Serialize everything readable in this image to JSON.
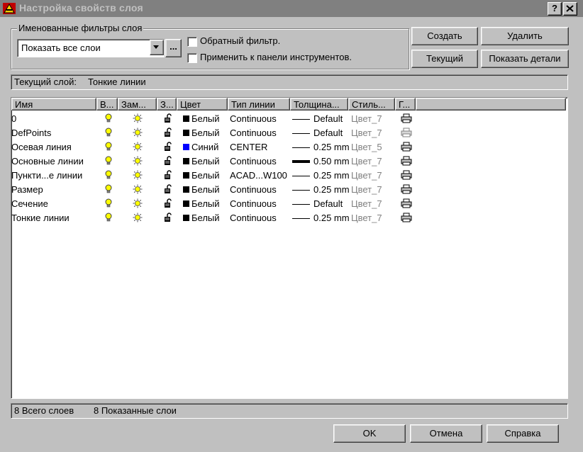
{
  "window": {
    "title": "Настройка свойств слоя",
    "help_glyph": "?",
    "close_glyph": "✕"
  },
  "filters": {
    "group_label": "Именованные фильтры слоя",
    "selected": "Показать все слои",
    "dots_label": "...",
    "invert_label": "Обратный фильтр.",
    "apply_toolbar_label": "Применить к панели инструментов."
  },
  "buttons": {
    "new": "Создать",
    "delete": "Удалить",
    "current": "Текущий",
    "show_details": "Показать детали",
    "ok": "OK",
    "cancel": "Отмена",
    "help": "Справка"
  },
  "current_layer": {
    "label": "Текущий слой:",
    "value": "Тонкие линии"
  },
  "columns": [
    "Имя",
    "В...",
    "Зам...",
    "З...",
    "Цвет",
    "Тип линии",
    "Толщина...",
    "Стиль...",
    "Г..."
  ],
  "layers": [
    {
      "name": "0",
      "color_name": "Белый",
      "color_hex": "#000000",
      "linetype": "Continuous",
      "lineweight": "Default",
      "lw_thick": false,
      "style": "Цвет_7",
      "plot": "on"
    },
    {
      "name": "DefPoints",
      "color_name": "Белый",
      "color_hex": "#000000",
      "linetype": "Continuous",
      "lineweight": "Default",
      "lw_thick": false,
      "style": "Цвет_7",
      "plot": "off"
    },
    {
      "name": "Осевая линия",
      "color_name": "Синий",
      "color_hex": "#0000ff",
      "linetype": "CENTER",
      "lineweight": "0.25 mm",
      "lw_thick": false,
      "style": "Цвет_5",
      "plot": "on"
    },
    {
      "name": "Основные линии",
      "color_name": "Белый",
      "color_hex": "#000000",
      "linetype": "Continuous",
      "lineweight": "0.50 mm",
      "lw_thick": true,
      "style": "Цвет_7",
      "plot": "on"
    },
    {
      "name": "Пункти...е линии",
      "color_name": "Белый",
      "color_hex": "#000000",
      "linetype": "ACAD...W100",
      "lineweight": "0.25 mm",
      "lw_thick": false,
      "style": "Цвет_7",
      "plot": "on"
    },
    {
      "name": "Размер",
      "color_name": "Белый",
      "color_hex": "#000000",
      "linetype": "Continuous",
      "lineweight": "0.25 mm",
      "lw_thick": false,
      "style": "Цвет_7",
      "plot": "on"
    },
    {
      "name": "Сечение",
      "color_name": "Белый",
      "color_hex": "#000000",
      "linetype": "Continuous",
      "lineweight": "Default",
      "lw_thick": false,
      "style": "Цвет_7",
      "plot": "on"
    },
    {
      "name": "Тонкие линии",
      "color_name": "Белый",
      "color_hex": "#000000",
      "linetype": "Continuous",
      "lineweight": "0.25 mm",
      "lw_thick": false,
      "style": "Цвет_7",
      "plot": "on"
    }
  ],
  "icons": {
    "on": "lightbulb-icon",
    "freeze": "sun-icon",
    "lock": "unlocked-padlock-icon",
    "plot": "printer-icon"
  },
  "status": {
    "total": "8 Всего слоев",
    "shown": "8 Показанные слои"
  },
  "colors": {
    "face": "#c0c0c0",
    "titlebar": "#808080",
    "bulb": "#ffff00",
    "list_bg": "#ffffff"
  }
}
